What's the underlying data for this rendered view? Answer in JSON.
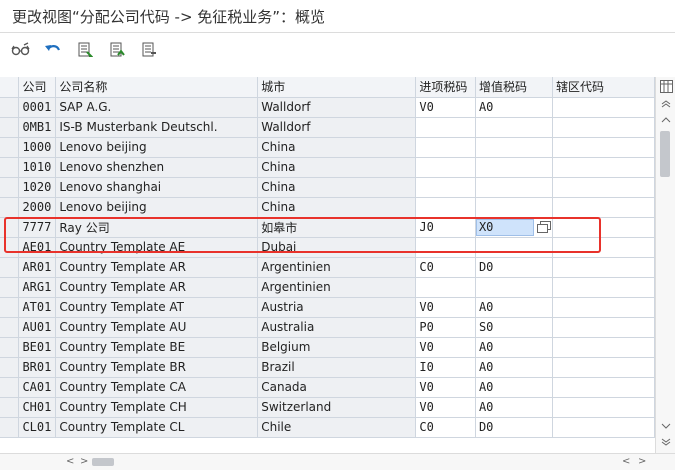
{
  "title": "更改视图“分配公司代码 -> 免征税业务”：概览",
  "toolbar": [
    {
      "icon": "glasses-icon"
    },
    {
      "icon": "undo-icon"
    },
    {
      "icon": "select-all-icon"
    },
    {
      "icon": "select-block-icon"
    },
    {
      "icon": "deselect-all-icon"
    }
  ],
  "table": {
    "columns": [
      "公司",
      "公司名称",
      "城市",
      "进项税码",
      "增值税码",
      "辖区代码"
    ],
    "rows": [
      [
        "0001",
        "SAP A.G.",
        "Walldorf",
        "V0",
        "A0",
        ""
      ],
      [
        "0MB1",
        "IS-B Musterbank Deutschl.",
        "Walldorf",
        "",
        "",
        ""
      ],
      [
        "1000",
        "Lenovo beijing",
        "China",
        "",
        "",
        ""
      ],
      [
        "1010",
        "Lenovo shenzhen",
        "China",
        "",
        "",
        ""
      ],
      [
        "1020",
        "Lenovo shanghai",
        "China",
        "",
        "",
        ""
      ],
      [
        "2000",
        "Lenovo beijing",
        "China",
        "",
        "",
        ""
      ],
      [
        "7777",
        "Ray 公司",
        "如皋市",
        "J0",
        "X0",
        ""
      ],
      [
        "AE01",
        "Country Template AE",
        "Dubai",
        "",
        "",
        ""
      ],
      [
        "AR01",
        "Country Template AR",
        "Argentinien",
        "C0",
        "D0",
        ""
      ],
      [
        "ARG1",
        "Country Template AR",
        "Argentinien",
        "",
        "",
        ""
      ],
      [
        "AT01",
        "Country Template AT",
        "Austria",
        "V0",
        "A0",
        ""
      ],
      [
        "AU01",
        "Country Template AU",
        "Australia",
        "P0",
        "S0",
        ""
      ],
      [
        "BE01",
        "Country Template BE",
        "Belgium",
        "V0",
        "A0",
        ""
      ],
      [
        "BR01",
        "Country Template BR",
        "Brazil",
        "I0",
        "A0",
        ""
      ],
      [
        "CA01",
        "Country Template CA",
        "Canada",
        "V0",
        "A0",
        ""
      ],
      [
        "CH01",
        "Country Template CH",
        "Switzerland",
        "V0",
        "A0",
        ""
      ],
      [
        "CL01",
        "Country Template CL",
        "Chile",
        "C0",
        "D0",
        ""
      ]
    ],
    "selected_row": 6,
    "selected_cell_value": "X0"
  },
  "colors": {
    "highlight": "#e8322b",
    "selected_field": "#cfe3fb"
  }
}
